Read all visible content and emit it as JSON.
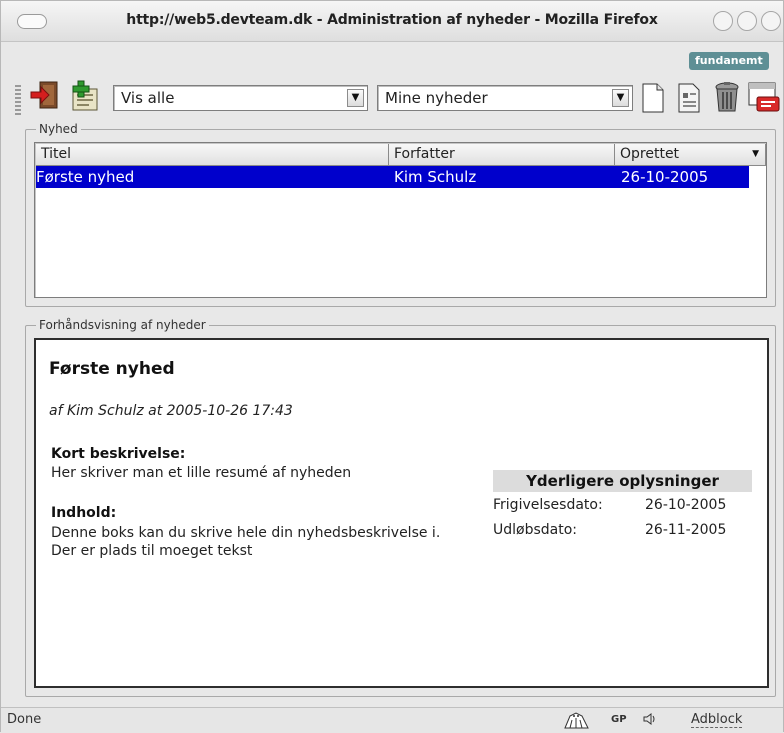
{
  "window": {
    "title": "http://web5.devteam.dk - Administration af nyheder - Mozilla Firefox"
  },
  "brand_badge": "fundanemt",
  "toolbar": {
    "filter_select": {
      "value": "Vis alle"
    },
    "category_select": {
      "value": "Mine nyheder"
    },
    "icons": [
      "exit-icon",
      "add-news-icon",
      "new-document-icon",
      "document-list-icon",
      "trash-icon",
      "presentation-icon"
    ]
  },
  "news_group": {
    "legend": "Nyhed",
    "columns": [
      "Titel",
      "Forfatter",
      "Oprettet"
    ],
    "rows": [
      {
        "titel": "Første nyhed",
        "forfatter": "Kim Schulz",
        "oprettet": "26-10-2005",
        "selected": true
      }
    ]
  },
  "preview_group": {
    "legend": "Forhåndsvisning af nyheder",
    "title": "Første nyhed",
    "byline": "af Kim Schulz at 2005-10-26 17:43",
    "short_label": "Kort beskrivelse:",
    "short_text": "Her skriver man et lille resumé af nyheden",
    "content_label": "Indhold:",
    "content_text": "Denne boks kan du skrive hele din nyhedsbeskrivelse i. Der er plads til moeget tekst",
    "info": {
      "heading": "Yderligere oplysninger",
      "release_label": "Frigivelsesdato:",
      "release_value": "26-10-2005",
      "expiry_label": "Udløbsdato:",
      "expiry_value": "26-11-2005"
    }
  },
  "statusbar": {
    "status": "Done",
    "gp_label": "GP",
    "adblock_label": "Adblock"
  },
  "colors": {
    "selection": "#0000cc",
    "badge": "#5e8f95"
  }
}
